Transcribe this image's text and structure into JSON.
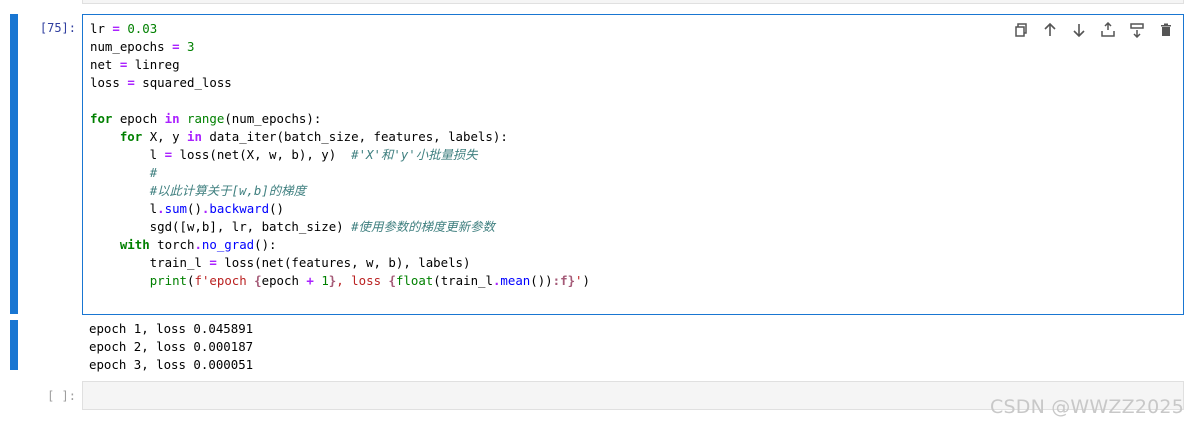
{
  "cells": [
    {
      "prompt": "[75]:",
      "code_lines": [
        [
          {
            "t": "lr "
          },
          {
            "t": "=",
            "c": "o"
          },
          {
            "t": " "
          },
          {
            "t": "0.03",
            "c": "m"
          }
        ],
        [
          {
            "t": "num_epochs "
          },
          {
            "t": "=",
            "c": "o"
          },
          {
            "t": " "
          },
          {
            "t": "3",
            "c": "m"
          }
        ],
        [
          {
            "t": "net "
          },
          {
            "t": "=",
            "c": "o"
          },
          {
            "t": " linreg"
          }
        ],
        [
          {
            "t": "loss "
          },
          {
            "t": "=",
            "c": "o"
          },
          {
            "t": " squared_loss"
          }
        ],
        [],
        [
          {
            "t": "for",
            "c": "k"
          },
          {
            "t": " epoch "
          },
          {
            "t": "in",
            "c": "o"
          },
          {
            "t": " "
          },
          {
            "t": "range",
            "c": "b"
          },
          {
            "t": "(num_epochs):"
          }
        ],
        [
          {
            "t": "    "
          },
          {
            "t": "for",
            "c": "k"
          },
          {
            "t": " X, y "
          },
          {
            "t": "in",
            "c": "o"
          },
          {
            "t": " data_iter(batch_size, features, labels):"
          }
        ],
        [
          {
            "t": "        l "
          },
          {
            "t": "=",
            "c": "o"
          },
          {
            "t": " loss(net(X, w, b), y)  "
          },
          {
            "t": "#'X'和'y'小批量损失",
            "c": "c"
          }
        ],
        [
          {
            "t": "        "
          },
          {
            "t": "#",
            "c": "c"
          }
        ],
        [
          {
            "t": "        "
          },
          {
            "t": "#以此计算关于[w,b]的梯度",
            "c": "c"
          }
        ],
        [
          {
            "t": "        l"
          },
          {
            "t": ".",
            "c": "o"
          },
          {
            "t": "sum",
            "c": "f"
          },
          {
            "t": "()"
          },
          {
            "t": ".",
            "c": "o"
          },
          {
            "t": "backward",
            "c": "f"
          },
          {
            "t": "()"
          }
        ],
        [
          {
            "t": "        sgd([w,b], lr, batch_size) "
          },
          {
            "t": "#使用参数的梯度更新参数",
            "c": "c"
          }
        ],
        [
          {
            "t": "    "
          },
          {
            "t": "with",
            "c": "k"
          },
          {
            "t": " torch"
          },
          {
            "t": ".",
            "c": "o"
          },
          {
            "t": "no_grad",
            "c": "f"
          },
          {
            "t": "():"
          }
        ],
        [
          {
            "t": "        train_l "
          },
          {
            "t": "=",
            "c": "o"
          },
          {
            "t": " loss(net(features, w, b), labels)"
          }
        ],
        [
          {
            "t": "        "
          },
          {
            "t": "print",
            "c": "b"
          },
          {
            "t": "("
          },
          {
            "t": "f",
            "c": "s"
          },
          {
            "t": "'epoch ",
            "c": "s"
          },
          {
            "t": "{",
            "c": "si"
          },
          {
            "t": "epoch "
          },
          {
            "t": "+",
            "c": "o"
          },
          {
            "t": " "
          },
          {
            "t": "1",
            "c": "m"
          },
          {
            "t": "}",
            "c": "si"
          },
          {
            "t": ", loss ",
            "c": "s"
          },
          {
            "t": "{",
            "c": "si"
          },
          {
            "t": "float",
            "c": "b"
          },
          {
            "t": "(train_l"
          },
          {
            "t": ".",
            "c": "o"
          },
          {
            "t": "mean",
            "c": "f"
          },
          {
            "t": "())"
          },
          {
            "t": ":f}",
            "c": "si"
          },
          {
            "t": "'",
            "c": "s"
          },
          {
            "t": ")"
          }
        ]
      ],
      "output_lines": [
        "epoch 1, loss 0.045891",
        "epoch 2, loss 0.000187",
        "epoch 3, loss 0.000051"
      ]
    },
    {
      "prompt": "[ ]:"
    }
  ],
  "toolbar": {
    "icons": [
      "duplicate-icon",
      "move-up-icon",
      "move-down-icon",
      "insert-above-icon",
      "insert-below-icon",
      "delete-icon"
    ]
  },
  "watermark": "CSDN @WWZZ2025",
  "colors": {
    "active_border": "#1976d2",
    "prompt": "#303f9f",
    "keyword": "#008000",
    "operator": "#aa22ff",
    "comment": "#408080"
  }
}
